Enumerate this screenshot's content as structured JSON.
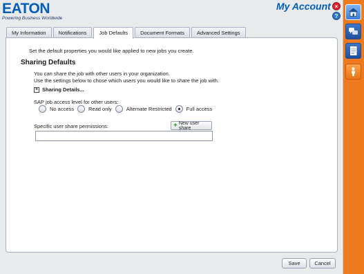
{
  "header": {
    "logo_text": "EATON",
    "tagline": "Powering Business Worldwide",
    "page_title": "My Account",
    "close_symbol": "×",
    "help_symbol": "?"
  },
  "tabs": [
    {
      "label": "My Information",
      "active": false
    },
    {
      "label": "Notifications",
      "active": false
    },
    {
      "label": "Job Defaults",
      "active": true
    },
    {
      "label": "Document Formats",
      "active": false
    },
    {
      "label": "Advanced Settings",
      "active": false
    }
  ],
  "content": {
    "intro": "Set the default properties you would like applied to new jobs you create.",
    "section_title": "Sharing Defaults",
    "description_line1": "You can share the job with other users in your organization.",
    "description_line2": "Use the settings below to chose which users you would like to share the job with.",
    "expander_symbol": "+",
    "expander_label": "Sharing Details...",
    "access_label": "SAP job access level for other users:",
    "access_options": [
      {
        "label": "No access",
        "selected": false
      },
      {
        "label": "Read only",
        "selected": false
      },
      {
        "label": "Alternate Restricted",
        "selected": false
      },
      {
        "label": "Full access",
        "selected": true
      }
    ],
    "permissions_label": "Specific user share permissions:",
    "new_share_icon": "+",
    "new_share_button": "New user share"
  },
  "footer": {
    "save": "Save",
    "cancel": "Cancel"
  },
  "sidebar": {
    "items": [
      {
        "icon": "home-icon",
        "active": true
      },
      {
        "icon": "chat-icon",
        "active": false
      },
      {
        "icon": "document-icon",
        "active": false
      },
      {
        "icon": "person-icon",
        "active": false
      }
    ]
  },
  "colors": {
    "brand_blue": "#005eb8",
    "sidebar_orange": "#ed7a1f",
    "close_red": "#d7262d"
  }
}
